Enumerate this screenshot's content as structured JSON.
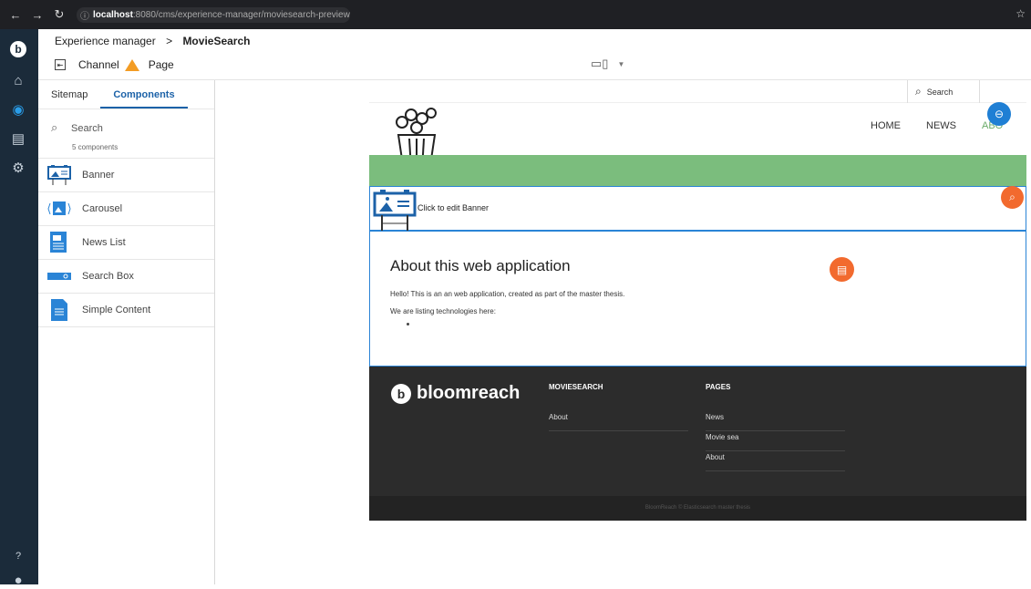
{
  "browser": {
    "url_host": "localhost",
    "url_rest": ":8080/cms/experience-manager/moviesearch-preview"
  },
  "topbar": {
    "breadcrumb_root": "Experience manager",
    "breadcrumb_sep": ">",
    "breadcrumb_current": "MovieSearch",
    "channel_label": "Channel",
    "page_label": "Page"
  },
  "sidepanel": {
    "tabs": [
      "Sitemap",
      "Components"
    ],
    "search_placeholder": "Search",
    "count_text": "5 components",
    "components": [
      "Banner",
      "Carousel",
      "News List",
      "Search Box",
      "Simple Content"
    ]
  },
  "preview": {
    "search_placeholder": "Search",
    "nav": [
      "HOME",
      "NEWS",
      "ABO"
    ],
    "banner_text": "Click to edit Banner",
    "heading": "About this web application",
    "paragraph1": "Hello! This is an an web application, created as part of the master thesis.",
    "paragraph2": "We are listing technologies here:",
    "footer": {
      "brand": "bloomreach",
      "col1_heading": "MOVIESEARCH",
      "col1_links": [
        "About"
      ],
      "col2_heading": "PAGES",
      "col2_links": [
        "News",
        "Movie sea",
        "About"
      ],
      "copyright": "BloomReach © Elasticsearch master thesis"
    }
  },
  "colors": {
    "accent": "#1c62a8",
    "orange": "#f26a2e",
    "green": "#7bbd7d",
    "warning": "#f39c24"
  }
}
